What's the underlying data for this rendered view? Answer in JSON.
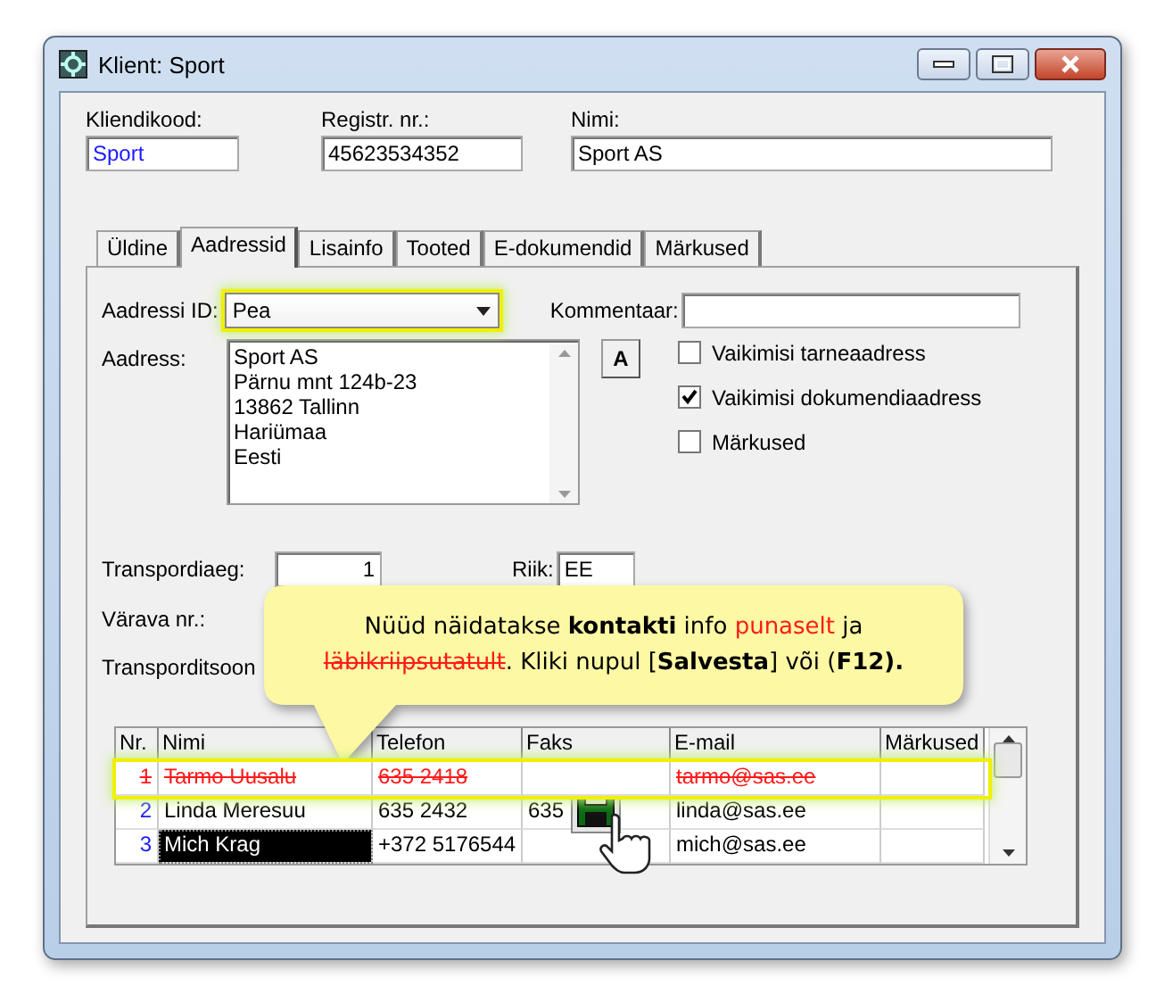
{
  "window": {
    "title": "Klient: Sport"
  },
  "header_fields": [
    {
      "label": "Kliendikood:",
      "value": "Sport",
      "kind": "code"
    },
    {
      "label": "Registr. nr.:",
      "value": "45623534352",
      "kind": "plain"
    },
    {
      "label": "Nimi:",
      "value": "Sport AS",
      "kind": "plain"
    }
  ],
  "tabs": [
    {
      "label": "Üldine",
      "selected": false
    },
    {
      "label": "Aadressid",
      "selected": true
    },
    {
      "label": "Lisainfo",
      "selected": false
    },
    {
      "label": "Tooted",
      "selected": false
    },
    {
      "label": "E-dokumendid",
      "selected": false
    },
    {
      "label": "Märkused",
      "selected": false
    }
  ],
  "address_id": {
    "label": "Aadressi ID:",
    "value": "Pea",
    "highlighted": true
  },
  "comment": {
    "label": "Kommentaar:"
  },
  "address": {
    "label": "Aadress:",
    "lines": [
      "Sport AS",
      "Pärnu mnt 124b-23",
      "13862 Tallinn",
      "Hariümaa",
      "Eesti"
    ]
  },
  "format_button": "A",
  "checkboxes": [
    {
      "label": "Vaikimisi tarneaadress",
      "checked": false
    },
    {
      "label": "Vaikimisi dokumendiaadress",
      "checked": true
    },
    {
      "label": "Märkused",
      "checked": false
    }
  ],
  "transport_time": {
    "label": "Transpordiaeg:",
    "value": "1"
  },
  "country": {
    "label": "Riik:",
    "value": "EE"
  },
  "gate": {
    "label": "Värava nr.:"
  },
  "transport_zone": {
    "label": "Transporditsoon"
  },
  "callout": {
    "segments": [
      {
        "text": "Nüüd näidatakse ",
        "kind": "plain"
      },
      {
        "text": "kontakti",
        "kind": "bold"
      },
      {
        "text": " info ",
        "kind": "plain"
      },
      {
        "text": "punaselt",
        "kind": "red"
      },
      {
        "text": " ja ",
        "kind": "plain"
      },
      {
        "text": "läbikriipsutatult",
        "kind": "struck"
      },
      {
        "text": ".  Kliki nupul [",
        "kind": "plain"
      },
      {
        "text": "Salvesta",
        "kind": "bold"
      },
      {
        "text": "] või (",
        "kind": "plain"
      },
      {
        "text": "F12).",
        "kind": "bold"
      }
    ]
  },
  "contacts": {
    "columns": [
      "Nr.",
      "Nimi",
      "Telefon",
      "Faks",
      "E-mail",
      "Märkused"
    ],
    "rows": [
      {
        "cells": [
          "1",
          "Tarmo Uusalu",
          "635 2418",
          "",
          "tarmo@sas.ee",
          ""
        ],
        "deleted": true,
        "highlighted": true,
        "selected": false
      },
      {
        "cells": [
          "2",
          "Linda Meresuu",
          "635 2432",
          "635",
          "linda@sas.ee",
          ""
        ],
        "deleted": false,
        "highlighted": false,
        "selected": false
      },
      {
        "cells": [
          "3",
          "Mich Krag",
          "+372 5176544",
          "",
          "mich@sas.ee",
          ""
        ],
        "deleted": false,
        "highlighted": false,
        "selected": true
      }
    ]
  }
}
